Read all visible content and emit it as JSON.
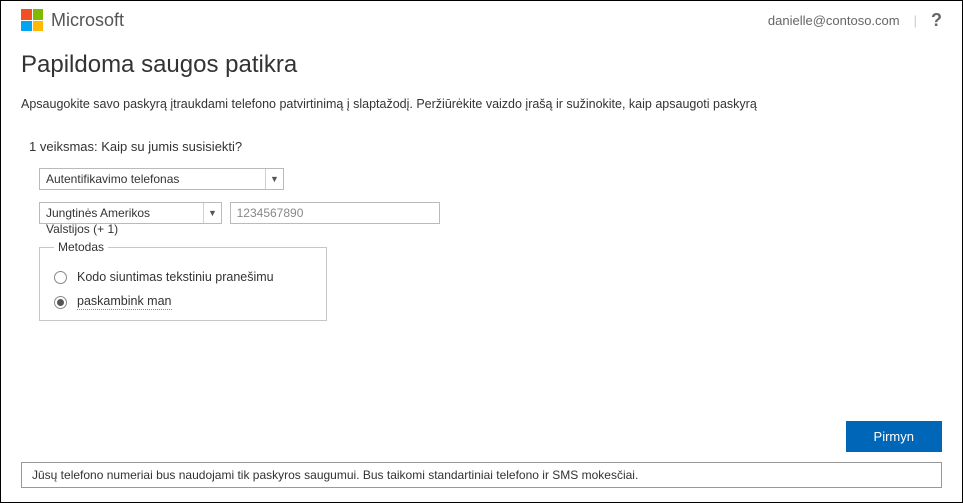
{
  "header": {
    "brand": "Microsoft",
    "user_email": "danielle@contoso.com",
    "help": "?"
  },
  "page": {
    "title": "Papildoma saugos patikra",
    "subtitle": "Apsaugokite savo paskyrą įtraukdami telefono patvirtinimą į slaptažodį. Peržiūrėkite vaizdo įrašą ir sužinokite, kaip apsaugoti paskyrą"
  },
  "step": {
    "prefix": "1 veiksmas:",
    "question": "Kaip su jumis susisiekti?"
  },
  "form": {
    "contact_method_selected": "Autentifikavimo telefonas",
    "country_selected": "Jungtinės Amerikos Valstijos (+ 1)",
    "phone_placeholder": "1234567890"
  },
  "method": {
    "legend": "Metodas",
    "option_sms": "Kodo siuntimas tekstiniu pranešimu",
    "option_call": "paskambink man",
    "selected": "call"
  },
  "actions": {
    "next": "Pirmyn"
  },
  "footer": {
    "note": "Jūsų telefono numeriai bus naudojami tik paskyros saugumui. Bus taikomi standartiniai telefono ir SMS mokesčiai."
  }
}
